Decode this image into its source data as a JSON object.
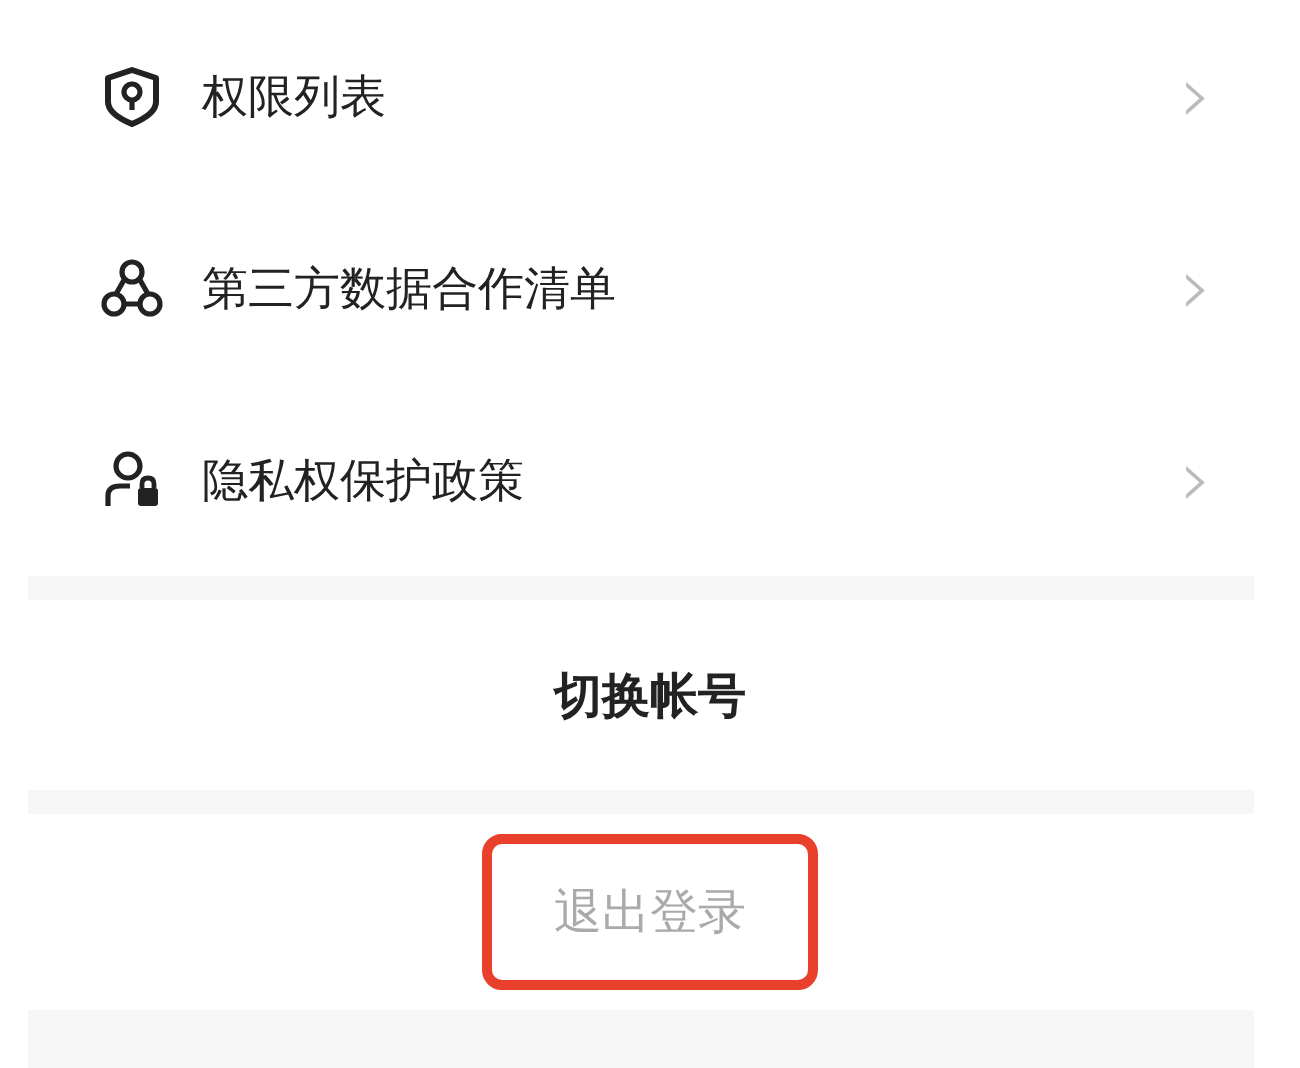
{
  "menu_items": [
    {
      "label": "权限列表",
      "chevron": "›"
    },
    {
      "label": "第三方数据合作清单",
      "chevron": "›"
    },
    {
      "label": "隐私权保护政策",
      "chevron": "›"
    }
  ],
  "switch_account": {
    "label": "切换帐号"
  },
  "logout": {
    "label": "退出登录",
    "disabled": true,
    "highlighted": true
  }
}
